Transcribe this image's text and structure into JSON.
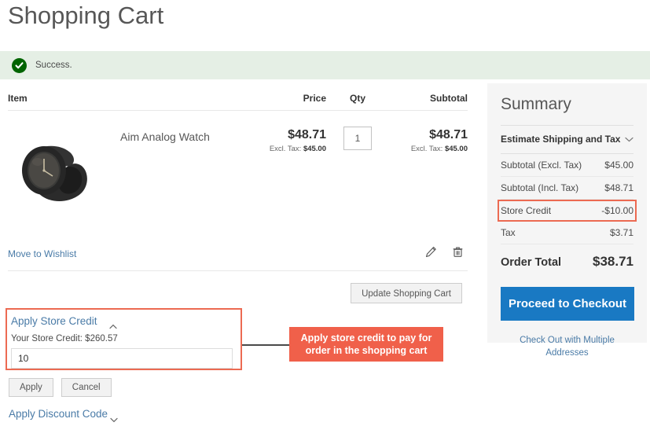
{
  "page": {
    "title": "Shopping Cart"
  },
  "message": {
    "icon": "check-circle-icon",
    "text": "Success.",
    "bg_color": "#e5efe5",
    "icon_color": "#006400"
  },
  "cart": {
    "columns": {
      "item": "Item",
      "price": "Price",
      "qty": "Qty",
      "subtotal": "Subtotal"
    },
    "rows": [
      {
        "name": "Aim Analog Watch",
        "image_alt": "black analog watch",
        "price": "$48.71",
        "price_excl_label": "Excl. Tax:",
        "price_excl_value": "$45.00",
        "qty": "1",
        "subtotal": "$48.71",
        "subtotal_excl_label": "Excl. Tax:",
        "subtotal_excl_value": "$45.00"
      }
    ],
    "move_to_wishlist": "Move to Wishlist",
    "edit_icon": "pencil-icon",
    "delete_icon": "trash-icon",
    "update_button": "Update Shopping Cart"
  },
  "store_credit": {
    "heading": "Apply Store Credit",
    "toggle_icon": "chevron-up-icon",
    "balance_label": "Your Store Credit: $260.57",
    "input_value": "10",
    "apply_button": "Apply",
    "cancel_button": "Cancel",
    "highlight_color": "#ec6a52"
  },
  "discount": {
    "heading": "Apply Discount Code",
    "toggle_icon": "chevron-down-icon"
  },
  "callout": {
    "text": "Apply store credit to pay for order in the shopping cart",
    "bg_color": "#f0604a",
    "text_color": "#ffffff"
  },
  "summary": {
    "title": "Summary",
    "estimate": {
      "label": "Estimate Shipping and Tax",
      "toggle_icon": "chevron-down-icon"
    },
    "rows": [
      {
        "label": "Subtotal (Excl. Tax)",
        "value": "$45.00",
        "highlighted": false
      },
      {
        "label": "Subtotal (Incl. Tax)",
        "value": "$48.71",
        "highlighted": false
      },
      {
        "label": "Store Credit",
        "value": "-$10.00",
        "highlighted": true
      },
      {
        "label": "Tax",
        "value": "$3.71",
        "highlighted": false
      }
    ],
    "total": {
      "label": "Order Total",
      "value": "$38.71"
    },
    "checkout_button": "Proceed to Checkout",
    "checkout_color": "#1979c3",
    "multiple_addresses": "Check Out with Multiple Addresses"
  }
}
